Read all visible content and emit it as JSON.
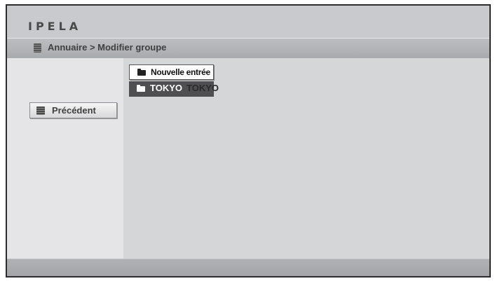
{
  "header": {
    "logo": "IPELA"
  },
  "breadcrumb": {
    "text": "Annuaire > Modifier groupe",
    "icon": "phonebook-icon"
  },
  "sidebar": {
    "back_label": "Précédent",
    "back_icon": "phonebook-icon"
  },
  "entries": [
    {
      "label": "Nouvelle entrée",
      "icon": "folder-icon",
      "selected": false
    },
    {
      "label": "TOKYO",
      "icon": "folder-icon",
      "selected": true
    }
  ],
  "ghost_text": "TOKYO",
  "colors": {
    "selected_bg": "#4f4f52",
    "screen_bg": "#d5d6d8",
    "sidebar_bg": "#e5e5e7"
  }
}
